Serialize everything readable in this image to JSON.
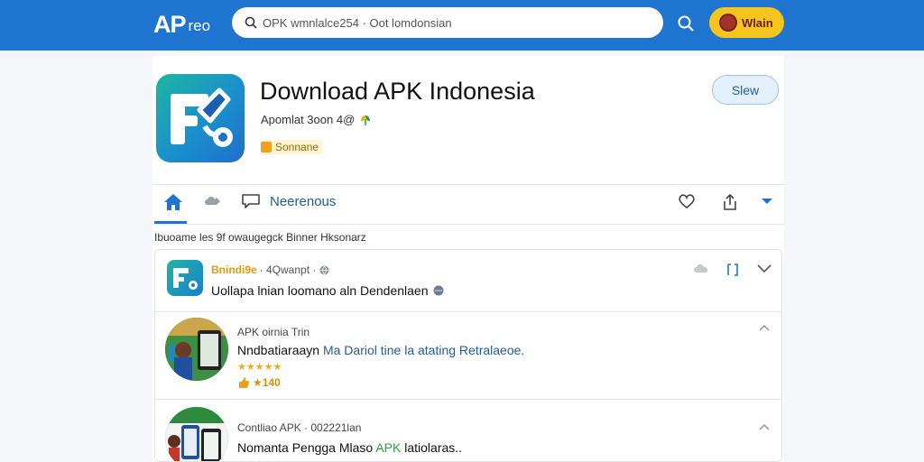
{
  "header": {
    "logo_main": "AP",
    "logo_sub": "reo",
    "search_value": "OPK wmnlalce254 · Oot lomdonsian",
    "user_label": "Wlain"
  },
  "app": {
    "title": "Download APK Indonesia",
    "developer": "Apomlat 3oon 4@",
    "tag": "Sonnane",
    "save_label": "Slew"
  },
  "toolbar": {
    "label": "Neerenous"
  },
  "caption": "Ibuoame les 9f owaugegck Binner Hksonarz",
  "post": {
    "author": "Bnindi9e",
    "meta": "· 4Qwanpt ·",
    "text": "Uollapa lnian loomano aln Dendenlaen"
  },
  "items": [
    {
      "subtitle": "APK oirnia Trin",
      "title_a": "Nndbatiaraayn ",
      "title_b": "Ma Dariol tine la atating Retralaeoe.",
      "stars": "★★★★★",
      "rating": "★140"
    },
    {
      "subtitle": "Contliao APK · 002221lan",
      "title_a": "Nomanta Pengga Mlaso ",
      "title_b": "APK",
      "title_c": " latiolaras..",
      "stars": "★★★★★"
    }
  ],
  "colors": {
    "header_bg": "#1f74d0",
    "accent": "#1f5d98",
    "user_button": "#f5c51d",
    "star": "#f0a815"
  },
  "icons": [
    "search-icon",
    "home-icon",
    "cloud-icon",
    "message-icon",
    "heart-icon",
    "share-icon",
    "chevron-down-icon",
    "globe-icon",
    "bookmark-icon",
    "chevron-up-icon",
    "leaf-icon",
    "tag-icon"
  ]
}
